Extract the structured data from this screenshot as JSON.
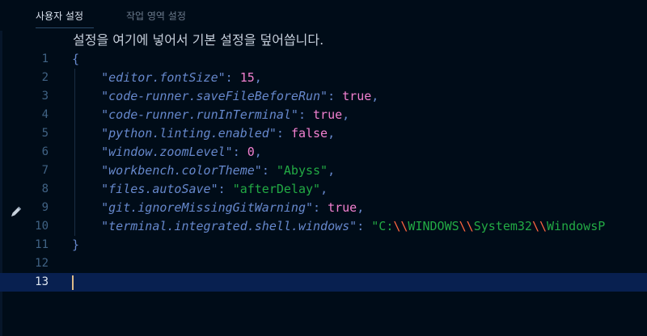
{
  "tabs": {
    "user_settings": "사용자 설정",
    "workspace_settings": "작업 영역 설정"
  },
  "hint": "설정을 여기에 넣어서 기본 설정을 덮어씁니다.",
  "editor": {
    "line_numbers": [
      "1",
      "2",
      "3",
      "4",
      "5",
      "6",
      "7",
      "8",
      "9",
      "10",
      "11",
      "12",
      "13"
    ],
    "open_brace": "{",
    "close_brace": "}",
    "settings": [
      {
        "key": "\"editor.fontSize\"",
        "value": "15",
        "type": "num"
      },
      {
        "key": "\"code-runner.saveFileBeforeRun\"",
        "value": "true",
        "type": "bool"
      },
      {
        "key": "\"code-runner.runInTerminal\"",
        "value": "true",
        "type": "bool"
      },
      {
        "key": "\"python.linting.enabled\"",
        "value": "false",
        "type": "bool"
      },
      {
        "key": "\"window.zoomLevel\"",
        "value": "0",
        "type": "num"
      },
      {
        "key": "\"workbench.colorTheme\"",
        "value": "\"Abyss\"",
        "type": "str"
      },
      {
        "key": "\"files.autoSave\"",
        "value": "\"afterDelay\"",
        "type": "str"
      },
      {
        "key": "\"git.ignoreMissingGitWarning\"",
        "value": "true",
        "type": "bool"
      },
      {
        "key": "\"terminal.integrated.shell.windows\"",
        "value": "\"C:\\\\WINDOWS\\\\System32\\\\WindowsP",
        "type": "path"
      }
    ],
    "current_line": 13
  },
  "icons": {
    "gutter_edit": "pencil-icon"
  },
  "colors": {
    "background": "#000c18",
    "key": "#6688cc",
    "number_bool": "#f280d0",
    "string": "#22aa44",
    "escape": "#ff6540",
    "current_line": "#082050"
  }
}
